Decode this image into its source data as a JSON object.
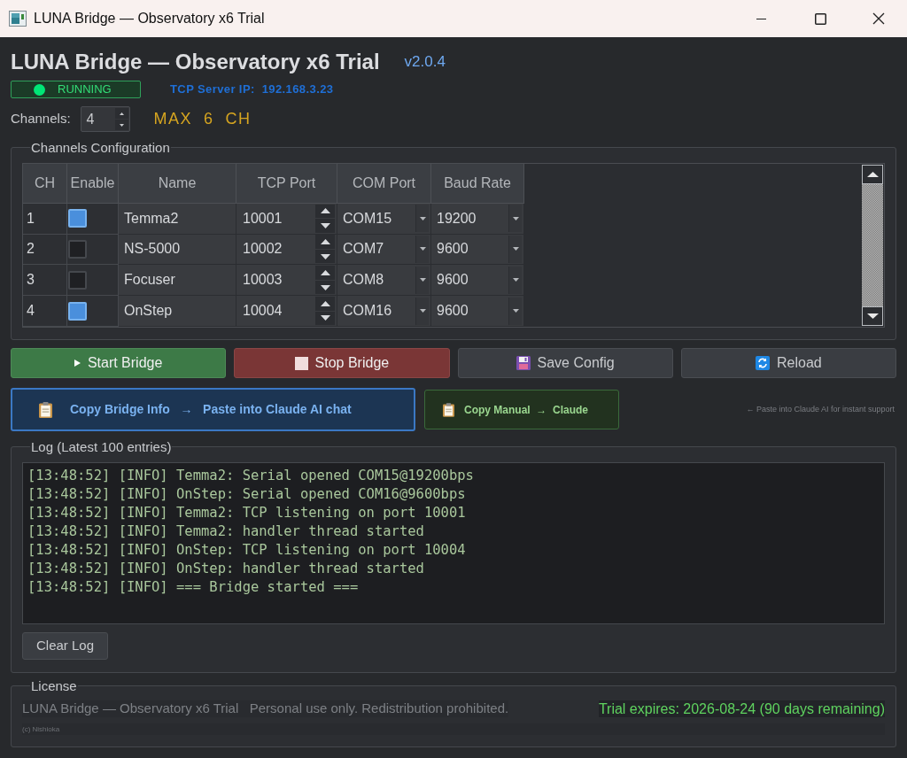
{
  "window": {
    "title": "LUNA Bridge — Observatory x6 Trial"
  },
  "header": {
    "title": "LUNA Bridge — Observatory x6 Trial",
    "version": "v2.0.4"
  },
  "status": {
    "label": "RUNNING",
    "running": true,
    "server_ip": "TCP Server IP:  192.168.3.23"
  },
  "channel_count": {
    "label": "Channels:",
    "value": "4",
    "max_note": "MAX  6  CH"
  },
  "channels_config": {
    "title": "Channels Configuration",
    "columns": [
      "CH",
      "Enable",
      "Name",
      "TCP Port",
      "COM Port",
      "Baud Rate"
    ],
    "rows": [
      {
        "ch": "1",
        "enabled": true,
        "name": "Temma2",
        "tcp_port": "10001",
        "com_port": "COM15",
        "baud_rate": "19200"
      },
      {
        "ch": "2",
        "enabled": false,
        "name": "NS-5000",
        "tcp_port": "10002",
        "com_port": "COM7",
        "baud_rate": "9600"
      },
      {
        "ch": "3",
        "enabled": false,
        "name": "Focuser",
        "tcp_port": "10003",
        "com_port": "COM8",
        "baud_rate": "9600"
      },
      {
        "ch": "4",
        "enabled": true,
        "name": "OnStep",
        "tcp_port": "10004",
        "com_port": "COM16",
        "baud_rate": "9600"
      }
    ]
  },
  "buttons": [
    {
      "kind": "start",
      "label": "Start Bridge"
    },
    {
      "kind": "stop",
      "label": "Stop Bridge"
    },
    {
      "kind": "save",
      "label": "Save Config"
    },
    {
      "kind": "reload",
      "label": "Reload"
    }
  ],
  "copy_buttons": [
    {
      "kind": "bridge_info",
      "label": "Copy Bridge Info   →   Paste into Claude AI chat"
    },
    {
      "kind": "manual",
      "label": "Copy Manual  →  Claude"
    }
  ],
  "copy_hint": "← Paste into Claude AI for instant support",
  "log": {
    "title": "Log (Latest 100 entries)",
    "lines": [
      "[13:48:52] [INFO] Temma2: Serial opened COM15@19200bps",
      "[13:48:52] [INFO] OnStep: Serial opened COM16@9600bps",
      "[13:48:52] [INFO] Temma2: TCP listening on port 10001",
      "[13:48:52] [INFO] Temma2: handler thread started",
      "[13:48:52] [INFO] OnStep: TCP listening on port 10004",
      "[13:48:52] [INFO] OnStep: handler thread started",
      "[13:48:52] [INFO] === Bridge started ==="
    ],
    "clear_button": "Clear Log"
  },
  "license": {
    "title": "License",
    "notice": "LUNA Bridge — Observatory x6 Trial   Personal use only. Redistribution prohibited.",
    "expiry": "Trial expires: 2026-08-24 (90 days remaining)",
    "copyright": "(c) Nishioka"
  }
}
